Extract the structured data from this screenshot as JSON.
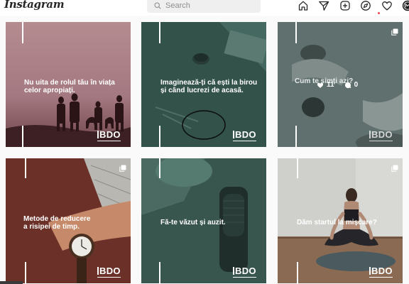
{
  "app": {
    "name": "Instagram"
  },
  "header": {
    "search_placeholder": "Search",
    "icons": [
      "home-icon",
      "direct-message-icon",
      "new-post-icon",
      "explore-icon",
      "activity-heart-icon",
      "profile-avatar"
    ]
  },
  "colors": {
    "notification_dot": "#ed4956",
    "bdo_white": "#ffffff"
  },
  "posts": [
    {
      "caption_lines": [
        "Nu uita de rolul tău în viața",
        "celor apropiați."
      ],
      "brand": "BDO",
      "multi": false
    },
    {
      "caption_lines": [
        "Imaginează-ți că ești la birou",
        "și când lucrezi de acasă."
      ],
      "brand": "BDO",
      "multi": false
    },
    {
      "caption_lines": [
        "Cum te simți azi?"
      ],
      "brand": "BDO",
      "multi": true,
      "likes": "11",
      "comments": "0"
    },
    {
      "caption_lines": [
        "Metode de reducere",
        "a risipei de timp."
      ],
      "brand": "BDO",
      "multi": true
    },
    {
      "caption_lines": [
        "Fă-te văzut și auzit."
      ],
      "brand": "BDO",
      "multi": false
    },
    {
      "caption_lines": [
        "Dăm startul la mișcare?"
      ],
      "brand": "BDO",
      "multi": true
    }
  ]
}
